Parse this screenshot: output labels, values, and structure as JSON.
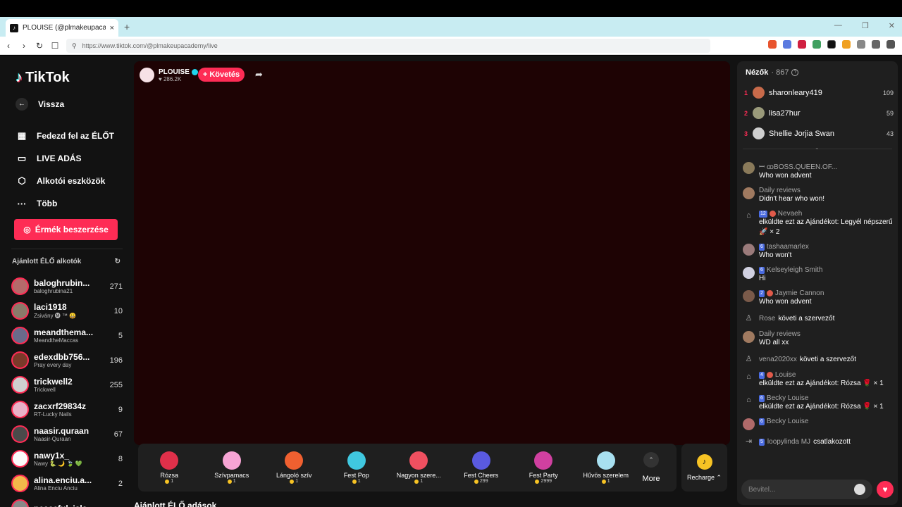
{
  "browser": {
    "tab_title": "PLOUISE (@plmakeupacademy)",
    "tab_close": "×",
    "new_tab": "+",
    "url": "https://www.tiktok.com/@plmakeupacademy/live",
    "window_controls": [
      "—",
      "❐",
      "✕"
    ]
  },
  "sidebar": {
    "logo": "TikTok",
    "back_label": "Vissza",
    "menu": [
      {
        "label": "Fedezd fel az ÉLŐT",
        "icon": "calendar-icon"
      },
      {
        "label": "LIVE ADÁS",
        "icon": "video-icon"
      },
      {
        "label": "Alkotói eszközök",
        "icon": "creator-tools-icon"
      },
      {
        "label": "Több",
        "icon": "more-icon"
      }
    ],
    "coins_button": "Érmék beszerzése",
    "recommended_title": "Ajánlott ÉLŐ alkotók",
    "creators": [
      {
        "name": "baloghrubin...",
        "sub": "baloghrubina21",
        "count": "271",
        "color": "#b56a6a"
      },
      {
        "name": "laci1918",
        "sub": "Zsivány 🅜 ™ 😀",
        "count": "10",
        "color": "#8a7a6a"
      },
      {
        "name": "meandthema...",
        "sub": "MeandtheMaccas",
        "count": "5",
        "color": "#6a6a8a"
      },
      {
        "name": "edexdbb756...",
        "sub": "Pray every day",
        "count": "196",
        "color": "#7a3a2a"
      },
      {
        "name": "trickwell2",
        "sub": "Trickwell",
        "count": "255",
        "color": "#cfcfcf"
      },
      {
        "name": "zacxrf29834z",
        "sub": "RT-Lucky Nails",
        "count": "9",
        "color": "#e8b2c8"
      },
      {
        "name": "naasir.quraan",
        "sub": "Naasir-Quraan",
        "count": "67",
        "color": "#4a4a4a"
      },
      {
        "name": "nawy1x_",
        "sub": "Nawy 🐍 🌙 🍃 💚",
        "count": "8",
        "color": "#fafafa"
      },
      {
        "name": "alina.enciu.a...",
        "sub": "Alina Enciu Anciu",
        "count": "2",
        "color": "#f2b84a"
      },
      {
        "name": "peaceful_isla...",
        "sub": "",
        "count": "",
        "color": "#888888"
      }
    ]
  },
  "stage": {
    "host_name": "PLOUISE",
    "host_likes": "♥ 286.2K",
    "follow_label": "+ Követés",
    "recommended_section": "Ajánlott ÉLŐ adások"
  },
  "gifts": [
    {
      "name": "Rózsa",
      "price": "1",
      "color": "#e0304a"
    },
    {
      "name": "Szívpamacs",
      "price": "1",
      "color": "#f6a4d4"
    },
    {
      "name": "Lángoló szív",
      "price": "1",
      "color": "#f06030"
    },
    {
      "name": "Fest Pop",
      "price": "1",
      "color": "#40c8e0"
    },
    {
      "name": "Nagyon szere...",
      "price": "1",
      "color": "#f05060"
    },
    {
      "name": "Fest Cheers",
      "price": "299",
      "color": "#5a5ae0"
    },
    {
      "name": "Fest Party",
      "price": "2999",
      "color": "#d040a0"
    },
    {
      "name": "Hűvös szerelem",
      "price": "1",
      "color": "#a8e0f0"
    }
  ],
  "more_label": "More",
  "recharge_label": "Recharge ⌃",
  "chat": {
    "viewers_label": "Nézők",
    "viewers_count": "· 867",
    "top_viewers": [
      {
        "rank": "1",
        "name": "sharonleary419",
        "score": "109",
        "color": "#c86a4a"
      },
      {
        "rank": "2",
        "name": "lisa27hur",
        "score": "59",
        "color": "#9a9a7a"
      },
      {
        "rank": "3",
        "name": "Shellie Jorjia Swan",
        "score": "43",
        "color": "#cfcfcf"
      }
    ],
    "messages": [
      {
        "type": "msg",
        "user": "ꟷ ꝏBOSS.QUEEN.OF...",
        "badge": "",
        "heart": false,
        "text": "Who won advent",
        "color": "#8a7a5a"
      },
      {
        "type": "msg",
        "user": "Daily reviews",
        "badge": "",
        "heart": false,
        "text": "Didn't hear who won!",
        "color": "#a07a60"
      },
      {
        "type": "gift",
        "user": "Nevaeh",
        "badge": "12",
        "heart": true,
        "text": "elküldte ezt az Ajándékot: Legyél népszerű 🚀 × 2"
      },
      {
        "type": "msg",
        "user": "tashaamarlex",
        "badge": "6",
        "heart": false,
        "text": "Who won't",
        "color": "#9a7a7a"
      },
      {
        "type": "msg",
        "user": "Kelseyleigh Smith",
        "badge": "6",
        "heart": false,
        "text": "Hi",
        "color": "#d0d0e0"
      },
      {
        "type": "msg",
        "user": "Jaymie Cannon",
        "badge": "2",
        "heart": true,
        "text": "Who won advent",
        "color": "#7a5a4a"
      },
      {
        "type": "follow",
        "user": "Rose",
        "text": "követi a szervezőt"
      },
      {
        "type": "msg",
        "user": "Daily reviews",
        "badge": "",
        "heart": false,
        "text": "WD all xx",
        "color": "#a07a60"
      },
      {
        "type": "follow",
        "user": "vena2020xx",
        "text": "követi a szervezőt"
      },
      {
        "type": "gift",
        "user": "Louise",
        "badge": "4",
        "heart": true,
        "text": "elküldte ezt az Ajándékot: Rózsa 🌹 × 1"
      },
      {
        "type": "gift",
        "user": "Becky Louise",
        "badge": "6",
        "heart": false,
        "text": "elküldte ezt az Ajándékot: Rózsa 🌹 × 1"
      },
      {
        "type": "msg",
        "user": "Becky Louise",
        "badge": "6",
        "heart": false,
        "text": "",
        "color": "#b06a6a"
      },
      {
        "type": "join",
        "user": "loopylinda MJ",
        "badge": "5",
        "text": "csatlakozott"
      }
    ],
    "input_placeholder": "Bevitel..."
  }
}
